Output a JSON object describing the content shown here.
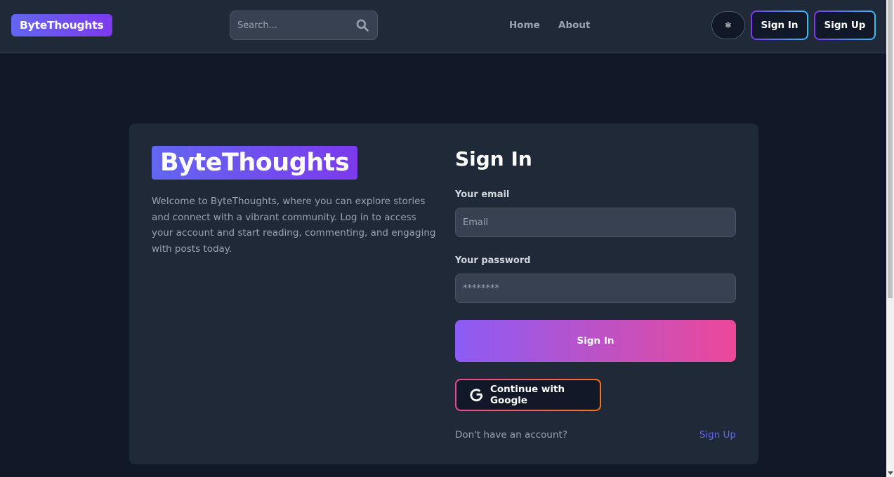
{
  "header": {
    "brand": "ByteThoughts",
    "search": {
      "placeholder": "Search..."
    },
    "nav": [
      {
        "label": "Home"
      },
      {
        "label": "About"
      }
    ],
    "theme_toggle_icon": "❄",
    "signin_label": "Sign In",
    "signup_label": "Sign Up"
  },
  "card": {
    "brand": "ByteThoughts",
    "welcome_text": "Welcome to ByteThoughts, where you can explore stories and connect with a vibrant community. Log in to access your account and start reading, commenting, and engaging with posts today.",
    "form": {
      "title": "Sign In",
      "email_label": "Your email",
      "email_placeholder": "Email",
      "password_label": "Your password",
      "password_placeholder": "********",
      "submit_label": "Sign In",
      "google_label": "Continue with Google",
      "no_account_text": "Don't have an account?",
      "signup_link": "Sign Up"
    }
  },
  "colors": {
    "background": "#111827",
    "surface": "#1f2937",
    "accent_start": "#8b5cf6",
    "accent_end": "#ec4899",
    "link": "#6366f1"
  }
}
